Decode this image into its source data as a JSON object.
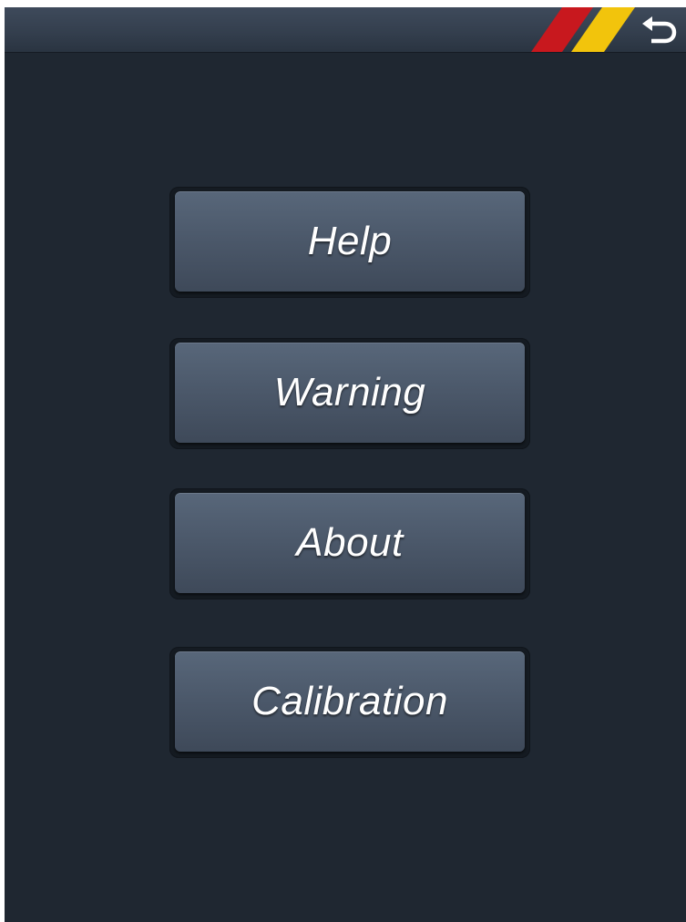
{
  "header": {
    "back_icon": "return-arrow-icon",
    "stripe_colors": [
      "#c8181e",
      "#f2c40c"
    ]
  },
  "menu": {
    "items": [
      {
        "label": "Help"
      },
      {
        "label": "Warning"
      },
      {
        "label": "About"
      },
      {
        "label": "Calibration"
      }
    ]
  },
  "colors": {
    "background": "#1f2731",
    "button": "#4c596b",
    "text": "#ffffff"
  }
}
